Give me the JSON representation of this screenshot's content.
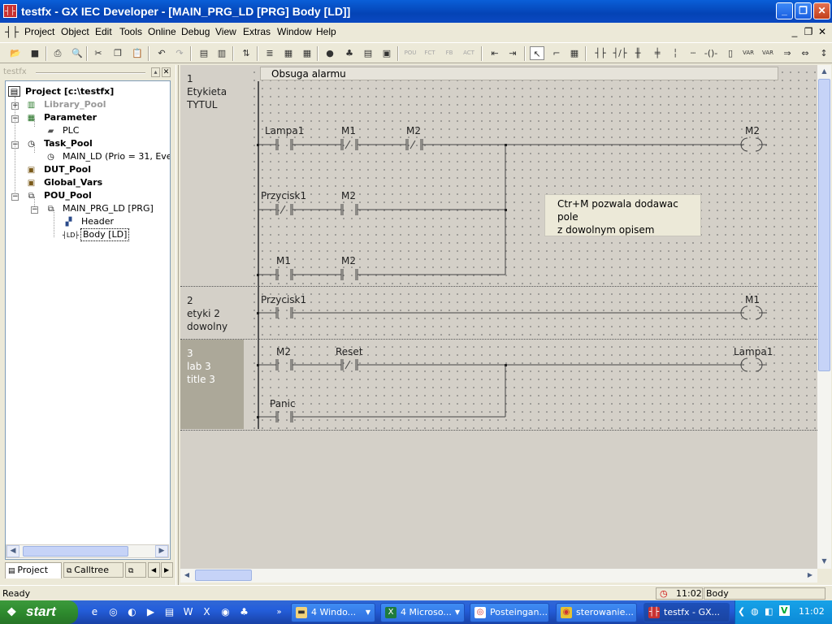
{
  "window": {
    "title": "testfx - GX IEC Developer - [MAIN_PRG_LD [PRG] Body [LD]]",
    "app_icon": "ladder-icon",
    "controls": [
      "minimize",
      "maximize",
      "close"
    ]
  },
  "menu": {
    "items": [
      "Project",
      "Object",
      "Edit",
      "Tools",
      "Online",
      "Debug",
      "View",
      "Extras",
      "Window",
      "Help"
    ]
  },
  "toolbar": {
    "buttons": [
      "open",
      "save",
      "print",
      "preview",
      "cut",
      "copy",
      "paste",
      "undo",
      "redo",
      "pou",
      "body",
      "import",
      "a",
      "b",
      "c",
      "compile",
      "monitor",
      "pou_tag",
      "fct_tag",
      "fb_tag",
      "act_tag",
      "seg_before",
      "seg_after",
      "select",
      "line",
      "box",
      "contact",
      "nc_contact",
      "parallel",
      "coil",
      "var_in",
      "var_out",
      "neg",
      "jump",
      "return"
    ]
  },
  "tree": {
    "header": "testfx",
    "root": "Project [c:\\testfx]",
    "library_pool": "Library_Pool",
    "parameter": "Parameter",
    "plc": "PLC",
    "task_pool": "Task_Pool",
    "main_ld": "MAIN_LD (Prio = 31, Event",
    "dut_pool": "DUT_Pool",
    "global_vars": "Global_Vars",
    "pou_pool": "POU_Pool",
    "main_prg": "MAIN_PRG_LD [PRG]",
    "header_item": "Header",
    "body_item": "Body [LD]"
  },
  "tabs": [
    "Project",
    "Calltree"
  ],
  "ladder": {
    "rungs": [
      {
        "num": "1",
        "label1": "Etykieta",
        "label2": "TYTUL",
        "comment": "Obsuga alarmu"
      },
      {
        "num": "2",
        "label1": "etyki 2",
        "label2": "dowolny"
      },
      {
        "num": "3",
        "label1": "lab 3",
        "label2": "title 3"
      }
    ],
    "r1": {
      "c_lampa1": "Lampa1",
      "c_m1": "M1",
      "c_m2": "M2",
      "coil_m2": "M2",
      "c_przycisk1": "Przycisk1",
      "c_m2b": "M2",
      "c_m1b": "M1",
      "c_m2c": "M2"
    },
    "r2": {
      "c_przycisk1": "Przycisk1",
      "coil_m1": "M1"
    },
    "r3": {
      "c_m2": "M2",
      "c_reset": "Reset",
      "coil_lampa1": "Lampa1",
      "c_panic": "Panic"
    },
    "note_line1": "Ctr+M pozwala dodawac pole",
    "note_line2": "z dowolnym opisem"
  },
  "status": {
    "left": "Ready",
    "time": "11:02",
    "right": "Body"
  },
  "taskbar": {
    "start": "start",
    "tasks": [
      {
        "label": "4 Windo...",
        "active": false
      },
      {
        "label": "4 Microso...",
        "active": false
      },
      {
        "label": "Posteingan...",
        "active": false
      },
      {
        "label": "sterowanie...",
        "active": false
      },
      {
        "label": "testfx - GX...",
        "active": true
      }
    ],
    "clock": "11:02"
  }
}
